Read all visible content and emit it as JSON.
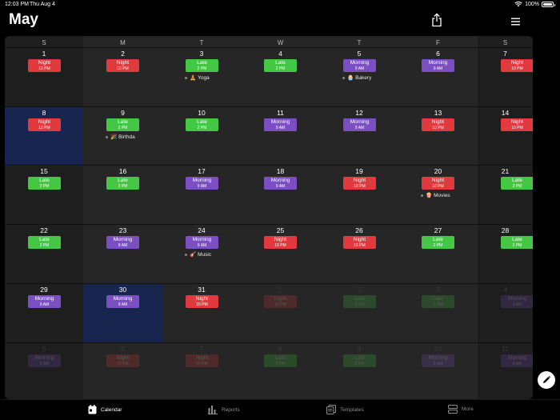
{
  "status_bar": {
    "time": "12:03 PM",
    "date": "Thu Aug 4",
    "battery": "100%"
  },
  "header": {
    "title": "May"
  },
  "colors": {
    "night": "#e0393e",
    "late": "#43c744",
    "morning": "#7b4fc3",
    "highlight": "#18264f"
  },
  "weekdays": [
    "S",
    "M",
    "T",
    "W",
    "T",
    "F",
    "S"
  ],
  "weeks": [
    [
      {
        "num": "1",
        "shift": "night",
        "label": "Night",
        "time": "10 PM"
      },
      {
        "num": "2",
        "shift": "night",
        "label": "Night",
        "time": "10 PM"
      },
      {
        "num": "3",
        "shift": "late",
        "label": "Late",
        "time": "2 PM",
        "event": "Yoga",
        "event_icon": "🧘"
      },
      {
        "num": "4",
        "shift": "late",
        "label": "Late",
        "time": "2 PM"
      },
      {
        "num": "5",
        "shift": "morning",
        "label": "Morning",
        "time": "9 AM",
        "event": "Bakery",
        "event_icon": "🧁"
      },
      {
        "num": "6",
        "shift": "morning",
        "label": "Morning",
        "time": "9 AM"
      },
      {
        "num": "7",
        "shift": "night",
        "label": "Night",
        "time": "10 PM"
      }
    ],
    [
      {
        "num": "8",
        "shift": "night",
        "label": "Night",
        "time": "10 PM",
        "highlight": true
      },
      {
        "num": "9",
        "shift": "late",
        "label": "Late",
        "time": "2 PM",
        "event": "Birthda",
        "event_icon": "🎉"
      },
      {
        "num": "10",
        "shift": "late",
        "label": "Late",
        "time": "2 PM"
      },
      {
        "num": "11",
        "shift": "morning",
        "label": "Morning",
        "time": "9 AM"
      },
      {
        "num": "12",
        "shift": "morning",
        "label": "Morning",
        "time": "9 AM"
      },
      {
        "num": "13",
        "shift": "night",
        "label": "Night",
        "time": "10 PM"
      },
      {
        "num": "14",
        "shift": "night",
        "label": "Night",
        "time": "10 PM"
      }
    ],
    [
      {
        "num": "15",
        "shift": "late",
        "label": "Late",
        "time": "2 PM"
      },
      {
        "num": "16",
        "shift": "late",
        "label": "Late",
        "time": "2 PM"
      },
      {
        "num": "17",
        "shift": "morning",
        "label": "Morning",
        "time": "9 AM"
      },
      {
        "num": "18",
        "shift": "morning",
        "label": "Morning",
        "time": "9 AM"
      },
      {
        "num": "19",
        "shift": "night",
        "label": "Night",
        "time": "10 PM"
      },
      {
        "num": "20",
        "shift": "night",
        "label": "Night",
        "time": "10 PM",
        "event": "Movies",
        "event_icon": "🍿"
      },
      {
        "num": "21",
        "shift": "late",
        "label": "Late",
        "time": "2 PM"
      }
    ],
    [
      {
        "num": "22",
        "shift": "late",
        "label": "Late",
        "time": "2 PM"
      },
      {
        "num": "23",
        "shift": "morning",
        "label": "Morning",
        "time": "9 AM"
      },
      {
        "num": "24",
        "shift": "morning",
        "label": "Morning",
        "time": "9 AM",
        "event": "Music",
        "event_icon": "🎸"
      },
      {
        "num": "25",
        "shift": "night",
        "label": "Night",
        "time": "10 PM"
      },
      {
        "num": "26",
        "shift": "night",
        "label": "Night",
        "time": "10 PM"
      },
      {
        "num": "27",
        "shift": "late",
        "label": "Late",
        "time": "2 PM"
      },
      {
        "num": "28",
        "shift": "late",
        "label": "Late",
        "time": "2 PM"
      }
    ],
    [
      {
        "num": "29",
        "shift": "morning",
        "label": "Morning",
        "time": "9 AM"
      },
      {
        "num": "30",
        "shift": "morning",
        "label": "Morning",
        "time": "9 AM",
        "highlight": true
      },
      {
        "num": "31",
        "shift": "night",
        "label": "Night",
        "time": "10 PM"
      },
      {
        "num": "1",
        "shift": "night",
        "label": "Night",
        "time": "10 PM",
        "dim": true
      },
      {
        "num": "2",
        "shift": "late",
        "label": "Late",
        "time": "2 PM",
        "dim": true
      },
      {
        "num": "3",
        "shift": "late",
        "label": "Late",
        "time": "2 PM",
        "dim": true
      },
      {
        "num": "4",
        "shift": "morning",
        "label": "Morning",
        "time": "9 AM",
        "dim": true
      }
    ],
    [
      {
        "num": "5",
        "shift": "morning",
        "label": "Morning",
        "time": "9 AM",
        "dim": true
      },
      {
        "num": "6",
        "shift": "night",
        "label": "Night",
        "time": "10 PM",
        "dim": true
      },
      {
        "num": "7",
        "shift": "night",
        "label": "Night",
        "time": "10 PM",
        "dim": true
      },
      {
        "num": "8",
        "shift": "late",
        "label": "Late",
        "time": "2 PM",
        "dim": true
      },
      {
        "num": "9",
        "shift": "late",
        "label": "Late",
        "time": "2 PM",
        "dim": true
      },
      {
        "num": "10",
        "shift": "morning",
        "label": "Morning",
        "time": "9 AM",
        "dim": true
      },
      {
        "num": "11",
        "shift": "morning",
        "label": "Morning",
        "time": "9 AM",
        "dim": true
      }
    ]
  ],
  "tabs": [
    {
      "label": "Calendar",
      "icon": "calendar-icon",
      "active": true
    },
    {
      "label": "Reports",
      "icon": "bar-chart-icon"
    },
    {
      "label": "Templates",
      "icon": "templates-icon"
    },
    {
      "label": "More",
      "icon": "more-icon"
    }
  ]
}
